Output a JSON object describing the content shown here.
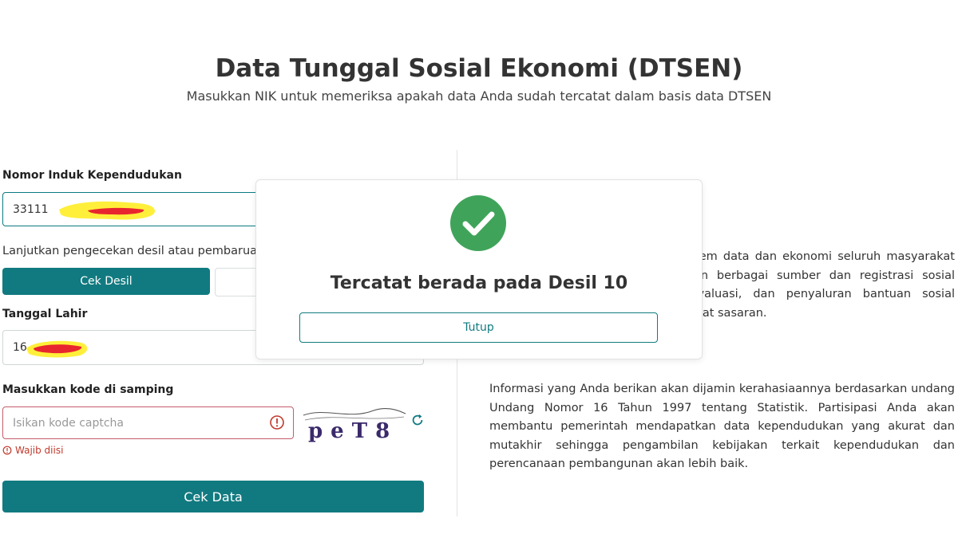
{
  "header": {
    "title": "Data Tunggal Sosial Ekonomi (DTSEN)",
    "subtitle": "Masukkan NIK untuk memeriksa apakah data Anda sudah tercatat dalam basis data DTSEN"
  },
  "form": {
    "nik_label": "Nomor Induk Kependudukan",
    "nik_value": "33111",
    "help_text": "Lanjutkan pengecekan desil atau pembaruan",
    "cek_desil_label": "Cek Desil",
    "dob_label": "Tanggal Lahir",
    "dob_value": "16",
    "captcha_label": "Masukkan kode di samping",
    "captcha_placeholder": "Isikan kode captcha",
    "captcha_code": "peT8",
    "required_error": "Wajib diisi",
    "submit_label": "Cek Data"
  },
  "info": {
    "paragraph1": "dan Ekonomi Nasional, sebuah sistem data dan ekonomi seluruh masyarakat Indonesia ungsi untuk menyatukan berbagai sumber dan registrasi sosial ekonomi) sehingga encanaan, evaluasi, dan penyaluran bantuan sosial (bansos) secara lebih akurat dan tepat sasaran.",
    "paragraph2": "Informasi yang Anda berikan akan dijamin kerahasiaannya berdasarkan undang Undang Nomor 16 Tahun 1997 tentang Statistik. Partisipasi Anda akan membantu pemerintah mendapatkan data kependudukan yang akurat dan mutakhir sehingga pengambilan kebijakan terkait kependudukan dan perencanaan pembangunan akan lebih baik."
  },
  "modal": {
    "message": "Tercatat berada pada Desil 10",
    "close_label": "Tutup"
  },
  "colors": {
    "primary": "#117a80",
    "success": "#3fa45a",
    "error": "#c0392b",
    "redaction_yellow": "#ffef3a",
    "redaction_red": "#e8262e"
  },
  "icons": {
    "success": "check-circle-icon",
    "error": "exclamation-circle-icon",
    "refresh": "refresh-icon"
  }
}
